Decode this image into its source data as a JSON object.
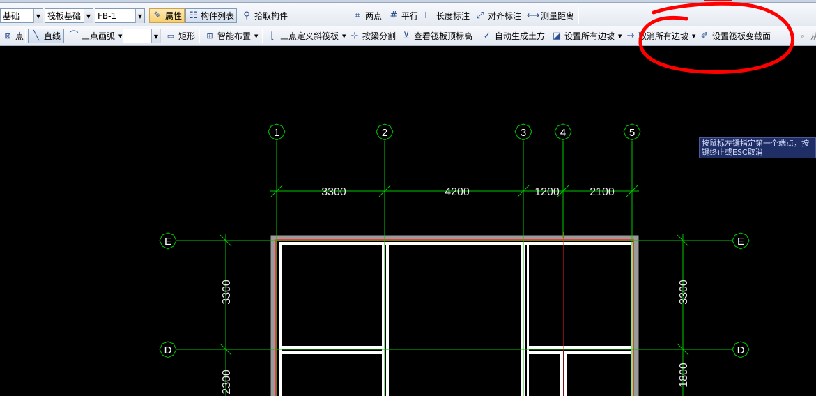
{
  "toolbar1": {
    "base_combo": "基础",
    "type_combo": "筏板基础",
    "component_combo": "FB-1",
    "properties_label": "属性",
    "component_list_label": "构件列表",
    "pick_component_label": "拾取构件",
    "two_points_label": "两点",
    "parallel_label": "平行",
    "length_dim_label": "长度标注",
    "align_dim_label": "对齐标注",
    "measure_distance_label": "测量距离"
  },
  "toolbar2": {
    "point_label": "点",
    "line_label": "直线",
    "arc_label": "三点画弧",
    "rect_label": "矩形",
    "smart_layout_label": "智能布置",
    "slope_raft_label": "三点定义斜筏板",
    "beam_split_label": "按梁分割",
    "view_top_elev_label": "查看筏板顶标高",
    "auto_earthwork_label": "自动生成土方",
    "set_all_slopes_label": "设置所有边坡",
    "cancel_all_slopes_label": "取消所有边坡",
    "set_section_change_label": "设置筏板变截面",
    "from_label": "从"
  },
  "tooltip": {
    "line1": "按鼠标左键指定第一个端点，按",
    "line2": "键终止或ESC取消"
  },
  "drawing": {
    "vertical_axes": [
      "1",
      "2",
      "3",
      "4",
      "5"
    ],
    "horizontal_axes": [
      "E",
      "D"
    ],
    "top_dimensions": [
      "3300",
      "4200",
      "1200",
      "2100"
    ],
    "left_dimensions": [
      "3300",
      "2300"
    ],
    "right_dimensions": [
      "3300",
      "1800"
    ],
    "colors": {
      "background": "#000000",
      "grid": "#00c800",
      "dimension_text": "#e8e8e8",
      "wall": "#ffffff",
      "raft_outline": "#ff2020",
      "annotation": "#ff0000"
    }
  }
}
